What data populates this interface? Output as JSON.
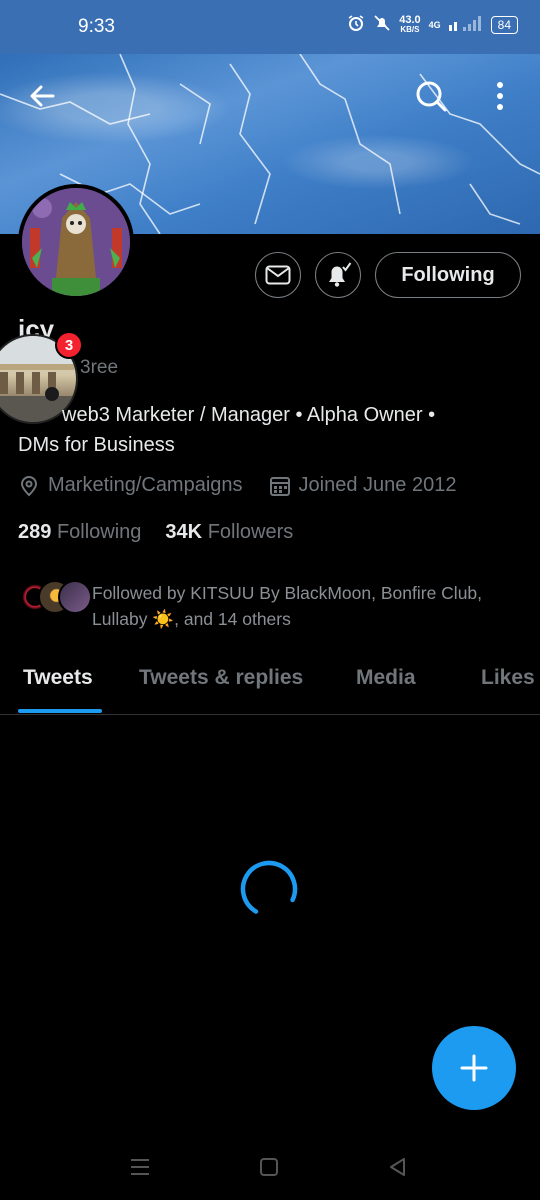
{
  "status_bar": {
    "time": "9:33",
    "net_speed": "43.0",
    "net_unit": "KB/S",
    "network": "4G",
    "battery": "84"
  },
  "icons": {
    "back": "back-arrow-icon",
    "search": "search-icon",
    "more": "more-vertical-icon",
    "message": "mail-icon",
    "notify": "bell-subscribed-icon",
    "location": "location-pin-icon",
    "calendar": "calendar-icon",
    "compose": "plus-icon"
  },
  "profile": {
    "display_name": "icy",
    "handle": "3ree",
    "bio_line1": "web3 Marketer / Manager • Alpha Owner •",
    "bio_line2": "DMs for Business",
    "location": "Marketing/Campaigns",
    "joined": "Joined June 2012",
    "following_count": "289",
    "following_label": "Following",
    "followers_count": "34K",
    "followers_label": "Followers",
    "followed_by": "Followed by KITSUU By BlackMoon, Bonfire Club, Lullaby ☀️, and 14 others"
  },
  "following_button": "Following",
  "chat_bubble": {
    "badge_count": "3"
  },
  "tabs": [
    {
      "label": "Tweets",
      "active": true
    },
    {
      "label": "Tweets & replies",
      "active": false
    },
    {
      "label": "Media",
      "active": false
    },
    {
      "label": "Likes",
      "active": false
    }
  ],
  "colors": {
    "accent": "#1d9bf0",
    "background": "#000000",
    "status_bar": "#3a6fb3",
    "badge": "#f4212e"
  }
}
